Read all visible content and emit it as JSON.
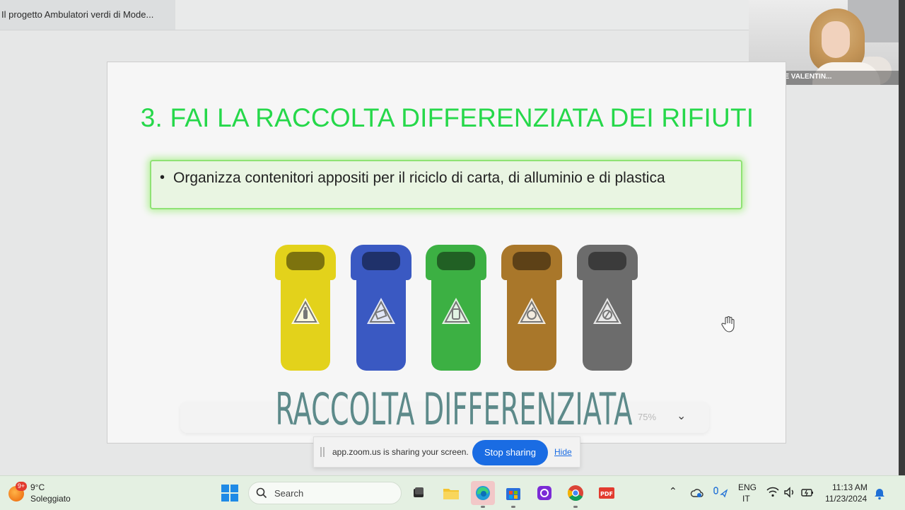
{
  "tab": {
    "title": "Il progetto Ambulatori verdi di Mode..."
  },
  "participant": {
    "name": "MINGRONE VALENTIN..."
  },
  "slide": {
    "title": "3. FAI LA RACCOLTA DIFFERENZIATA DEI RIFIUTI",
    "bullet": "Organizza contenitori appositi per il riciclo di carta, di alluminio e di plastica",
    "image_caption": "RACCOLTA DIFFERENZIATA",
    "bin_colors": [
      "#e3d21b",
      "#3a59c2",
      "#3cb043",
      "#a9772a",
      "#6c6c6c"
    ]
  },
  "pdf_toolbar": {
    "zoom": "75%"
  },
  "share_bar": {
    "message": "app.zoom.us is sharing your screen.",
    "stop_label": "Stop sharing",
    "hide_label": "Hide"
  },
  "taskbar": {
    "weather_badge": "9+",
    "temperature": "9°C",
    "weather_desc": "Soleggiato",
    "search_placeholder": "Search",
    "lang_primary": "ENG",
    "lang_secondary": "IT",
    "time": "11:13 AM",
    "date": "11/23/2024",
    "pinned_apps": [
      "task-view",
      "file-explorer",
      "edge",
      "microsoft-store",
      "app-purple",
      "chrome",
      "pdf-reader"
    ]
  }
}
